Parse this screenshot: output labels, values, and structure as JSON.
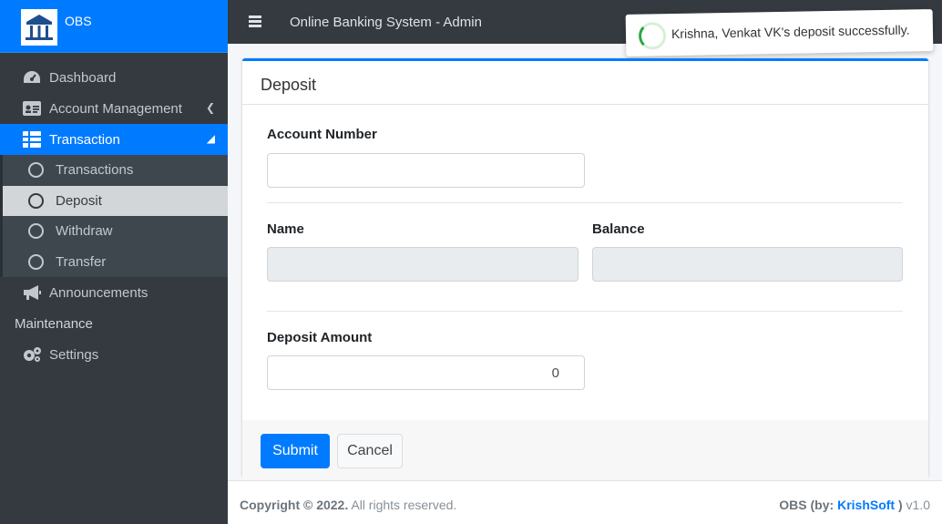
{
  "brand": {
    "name": "OBS",
    "logo_icon": "bank-icon"
  },
  "topbar": {
    "title": "Online Banking System - Admin",
    "menu_icon": "hamburger-icon"
  },
  "toast": {
    "message": "Krishna, Venkat VK's deposit successfully."
  },
  "sidebar": {
    "items": [
      {
        "label": "Dashboard",
        "icon": "tachometer-icon"
      },
      {
        "label": "Account Management",
        "icon": "id-card-icon"
      },
      {
        "label": "Transaction",
        "icon": "table-icon"
      }
    ],
    "sub_items": [
      {
        "label": "Transactions"
      },
      {
        "label": "Deposit"
      },
      {
        "label": "Withdraw"
      },
      {
        "label": "Transfer"
      }
    ],
    "announcements": {
      "label": "Announcements",
      "icon": "bullhorn-icon"
    },
    "header": "Maintenance",
    "settings": {
      "label": "Settings",
      "icon": "cogs-icon"
    }
  },
  "card": {
    "title": "Deposit",
    "account_number_label": "Account Number",
    "account_number_value": "",
    "name_label": "Name",
    "balance_label": "Balance",
    "deposit_amount_label": "Deposit Amount",
    "deposit_amount_value": "0",
    "submit_label": "Submit",
    "cancel_label": "Cancel"
  },
  "footer": {
    "copyright_bold": "Copyright © 2022.",
    "copyright_rest": " All rights reserved.",
    "app_prefix": "OBS (by: ",
    "author": "KrishSoft",
    "app_suffix": " )",
    "version": " v1.0"
  },
  "colors": {
    "primary": "#007bff",
    "sidebar": "#343a40",
    "success": "#28a745"
  }
}
